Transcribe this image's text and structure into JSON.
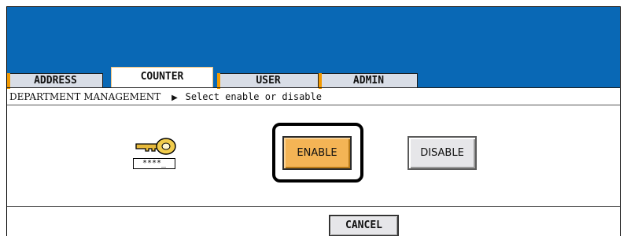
{
  "header": {
    "accent_color": "#0968b5",
    "tab_marker_color": "#f29900"
  },
  "tabs": [
    {
      "label": "ADDRESS",
      "active": false
    },
    {
      "label": "COUNTER",
      "active": true
    },
    {
      "label": "USER",
      "active": false
    },
    {
      "label": "ADMIN",
      "active": false
    }
  ],
  "breadcrumb": {
    "section": "DEPARTMENT MANAGEMENT",
    "separator_icon": "triangle-right-icon",
    "instruction": "Select enable or disable"
  },
  "key_icon": {
    "icon": "key-icon",
    "code_mask": "****_"
  },
  "options": {
    "enable_label": "ENABLE",
    "disable_label": "DISABLE",
    "selected": "ENABLE",
    "selected_color": "#f4b455"
  },
  "footer": {
    "cancel_label": "CANCEL"
  }
}
